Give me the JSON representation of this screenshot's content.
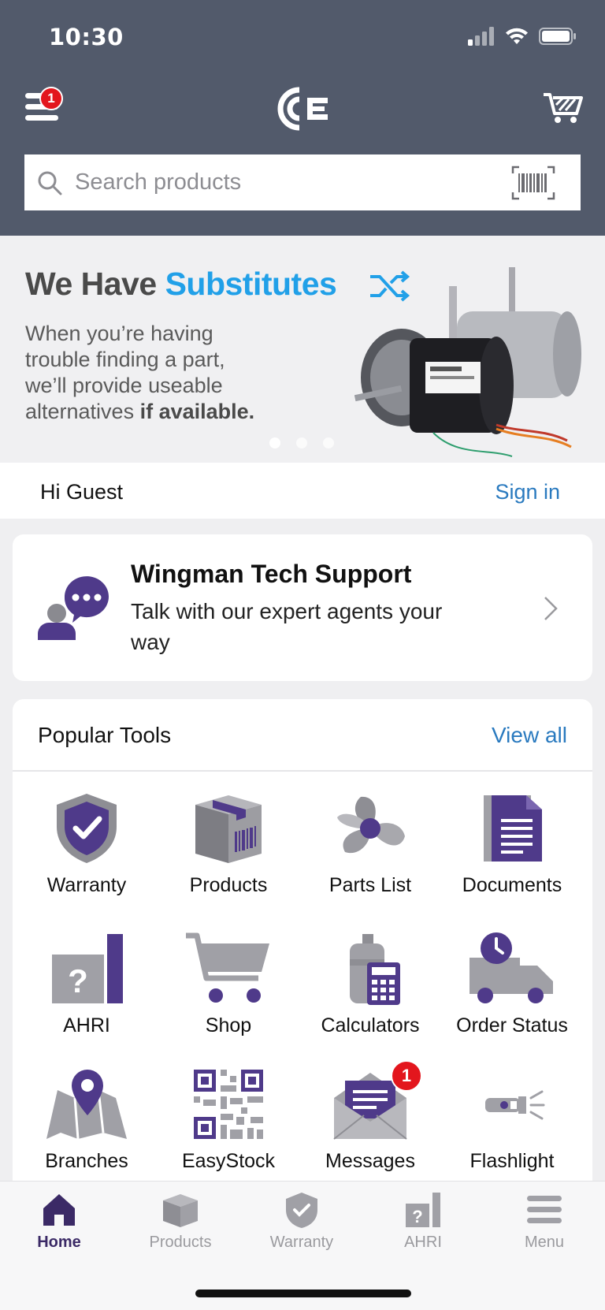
{
  "status_bar": {
    "time": "10:30"
  },
  "header": {
    "menu_badge": "1",
    "search": {
      "placeholder": "Search products"
    }
  },
  "banner": {
    "title_prefix": "We Have ",
    "title_accent": "Substitutes",
    "body_line1": "When you’re having",
    "body_line2": "trouble finding a part,",
    "body_line3": "we’ll provide useable",
    "body_line4_prefix": "alternatives ",
    "body_line4_bold": "if available."
  },
  "greeting": {
    "text": "Hi Guest",
    "signin": "Sign in"
  },
  "wingman": {
    "title": "Wingman Tech Support",
    "subtitle": "Talk with our expert agents your way"
  },
  "popular_tools": {
    "title": "Popular Tools",
    "view_all": "View all",
    "items": [
      {
        "label": "Warranty",
        "icon": "shield-check-icon"
      },
      {
        "label": "Products",
        "icon": "box-icon"
      },
      {
        "label": "Parts List",
        "icon": "fan-icon"
      },
      {
        "label": "Documents",
        "icon": "document-icon"
      },
      {
        "label": "AHRI",
        "icon": "ahri-icon"
      },
      {
        "label": "Shop",
        "icon": "cart-icon"
      },
      {
        "label": "Calculators",
        "icon": "calculator-icon"
      },
      {
        "label": "Order Status",
        "icon": "truck-clock-icon"
      },
      {
        "label": "Branches",
        "icon": "map-pin-icon"
      },
      {
        "label": "EasyStock",
        "icon": "qr-code-icon"
      },
      {
        "label": "Messages",
        "icon": "envelope-icon",
        "badge": "1"
      },
      {
        "label": "Flashlight",
        "icon": "flashlight-icon"
      }
    ]
  },
  "tabbar": {
    "tabs": [
      {
        "label": "Home",
        "active": true
      },
      {
        "label": "Products"
      },
      {
        "label": "Warranty"
      },
      {
        "label": "AHRI"
      },
      {
        "label": "Menu"
      }
    ]
  },
  "colors": {
    "header_bg": "#525a6b",
    "accent_purple": "#4f3a8a",
    "link_blue": "#2a7abf",
    "banner_accent": "#21a0e8",
    "badge_red": "#e3161d"
  }
}
